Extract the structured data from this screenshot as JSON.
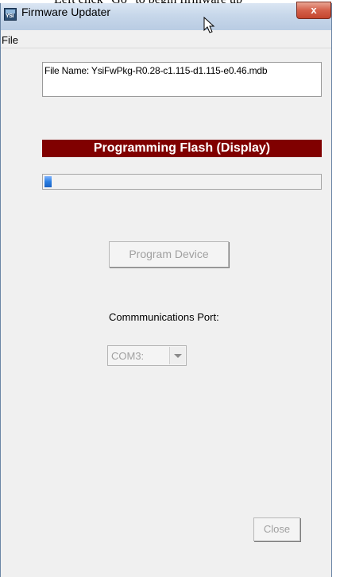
{
  "document": {
    "cropped_text": "Left click \"Go\" to begin firmware up"
  },
  "window": {
    "title": "Firmware Updater",
    "app_icon_text": "YSI",
    "close_glyph": "x"
  },
  "menu": {
    "file_label": "File"
  },
  "file_info": {
    "text": "File Name: YsiFwPkg-R0.28-c1.115-d1.115-e0.46.mdb"
  },
  "status": {
    "text": "Programming Flash (Display)",
    "color": "#800000"
  },
  "progress": {
    "fraction": 0.025,
    "color": "#2a7de1"
  },
  "program_button": {
    "label": "Program Device"
  },
  "port": {
    "label": "Commmunications Port:",
    "selected": "COM3:"
  },
  "close_button": {
    "label": "Close"
  }
}
